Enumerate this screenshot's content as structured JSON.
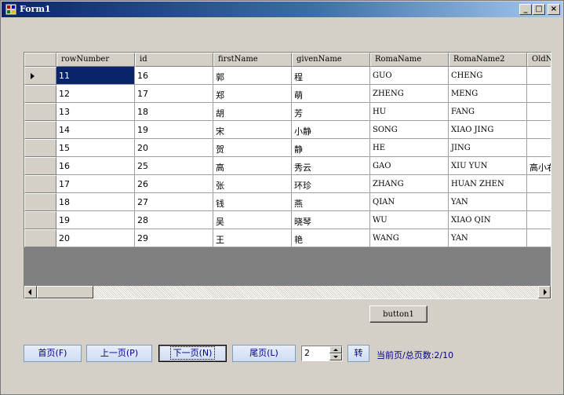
{
  "window": {
    "title": "Form1",
    "controls": {
      "minimize": "_",
      "maximize": "□",
      "close": "×"
    }
  },
  "grid": {
    "columns": [
      "rowNumber",
      "id",
      "firstName",
      "givenName",
      "RomaName",
      "RomaName2",
      "OldN"
    ],
    "rows": [
      [
        "11",
        "16",
        "郭",
        "程",
        "GUO",
        "CHENG",
        ""
      ],
      [
        "12",
        "17",
        "郑",
        "萌",
        "ZHENG",
        "MENG",
        ""
      ],
      [
        "13",
        "18",
        "胡",
        "芳",
        "HU",
        "FANG",
        ""
      ],
      [
        "14",
        "19",
        "宋",
        "小静",
        "SONG",
        "XIAO JING",
        ""
      ],
      [
        "15",
        "20",
        "贺",
        "静",
        "HE",
        "JING",
        ""
      ],
      [
        "16",
        "25",
        "高",
        "秀云",
        "GAO",
        "XIU YUN",
        "高小右"
      ],
      [
        "17",
        "26",
        "张",
        "环珍",
        "ZHANG",
        "HUAN ZHEN",
        ""
      ],
      [
        "18",
        "27",
        "钱",
        "燕",
        "QIAN",
        "YAN",
        ""
      ],
      [
        "19",
        "28",
        "吴",
        "晓琴",
        "WU",
        "XIAO QIN",
        ""
      ],
      [
        "20",
        "29",
        "王",
        "艳",
        "WANG",
        "YAN",
        ""
      ]
    ],
    "selected_row": 0
  },
  "buttons": {
    "button1": "button1",
    "first": "首页(F)",
    "prev": "上一页(P)",
    "next": "下一页(N)",
    "last": "尾页(L)",
    "go": "转"
  },
  "page_input": {
    "value": "2"
  },
  "status": {
    "text": "当前页/总页数:2/10"
  },
  "colors": {
    "title_start": "#0a246a",
    "title_end": "#a6caf0",
    "selection": "#0a246a",
    "button_blue": "#cfdcf3"
  }
}
